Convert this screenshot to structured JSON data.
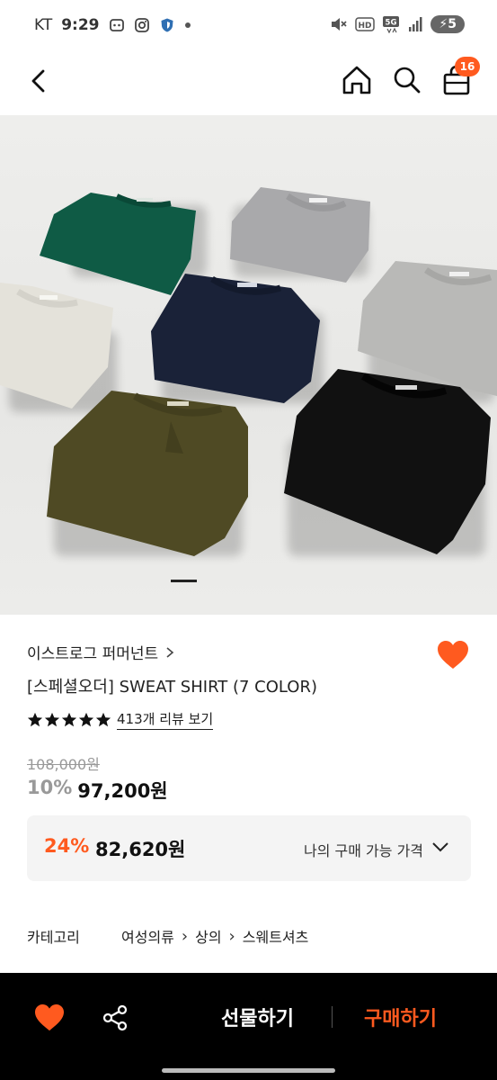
{
  "status_bar": {
    "carrier": "KT",
    "time": "9:29",
    "battery": "5",
    "network": "5G"
  },
  "nav": {
    "cart_count": "16",
    "icons": [
      "back-icon",
      "home-icon",
      "search-icon",
      "cart-icon"
    ]
  },
  "product": {
    "brand": "이스트로그 퍼머넌트",
    "title": "[스페셜오더] SWEAT SHIRT (7 COLOR)",
    "rating_stars": 5,
    "review_link": "413개 리뷰 보기",
    "original_price": "108,000원",
    "discount_rate": "10%",
    "sale_price": "97,200원"
  },
  "my_price": {
    "discount_rate": "24%",
    "price": "82,620원",
    "label": "나의 구매 가능 가격"
  },
  "category": {
    "label": "카테고리",
    "path": [
      "여성의류",
      "상의",
      "스웨트셔츠"
    ]
  },
  "bottom_bar": {
    "gift_label": "선물하기",
    "buy_label": "구매하기"
  },
  "colors": {
    "accent": "#ff5a1f",
    "sweatshirts": [
      "#0f5b45",
      "#a9a9ab",
      "#e4e2da",
      "#1a2238",
      "#b9b9b7",
      "#4f4a24",
      "#111111"
    ]
  }
}
